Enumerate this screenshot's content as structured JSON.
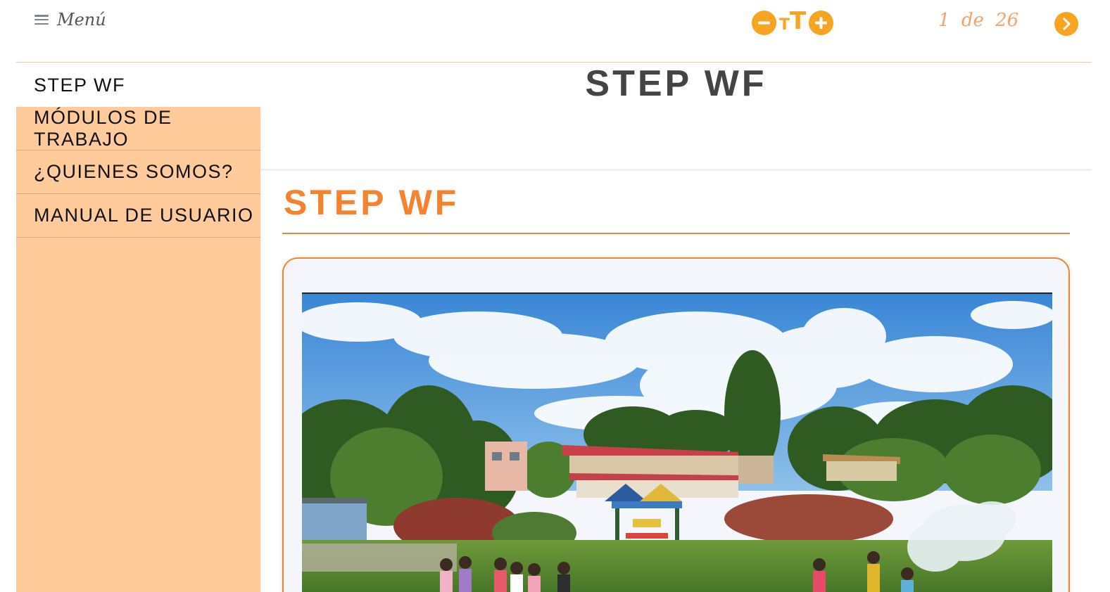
{
  "header": {
    "menu_label": "Menú",
    "pager": {
      "current": "1",
      "separator": "de",
      "total": "26"
    }
  },
  "sidebar": {
    "items": [
      {
        "label": "STEP WF",
        "active": true
      },
      {
        "label": "MÓDULOS DE TRABAJO",
        "active": false
      },
      {
        "label": "¿QUIENES SOMOS?",
        "active": false
      },
      {
        "label": "MANUAL DE USUARIO",
        "active": false
      }
    ]
  },
  "main": {
    "page_title": "STEP WF",
    "section_title": "STEP WF"
  },
  "icons": {
    "menu": "hamburger-icon",
    "decrease_font": "minus-circle-icon",
    "font_size": "text-size-icon",
    "increase_font": "plus-circle-icon",
    "next": "chevron-right-icon"
  },
  "colors": {
    "accent_orange": "#f5822d",
    "button_orange": "#f7a520",
    "sidebar_bg": "#ffcb9a",
    "pager_text": "#f4a36b"
  }
}
